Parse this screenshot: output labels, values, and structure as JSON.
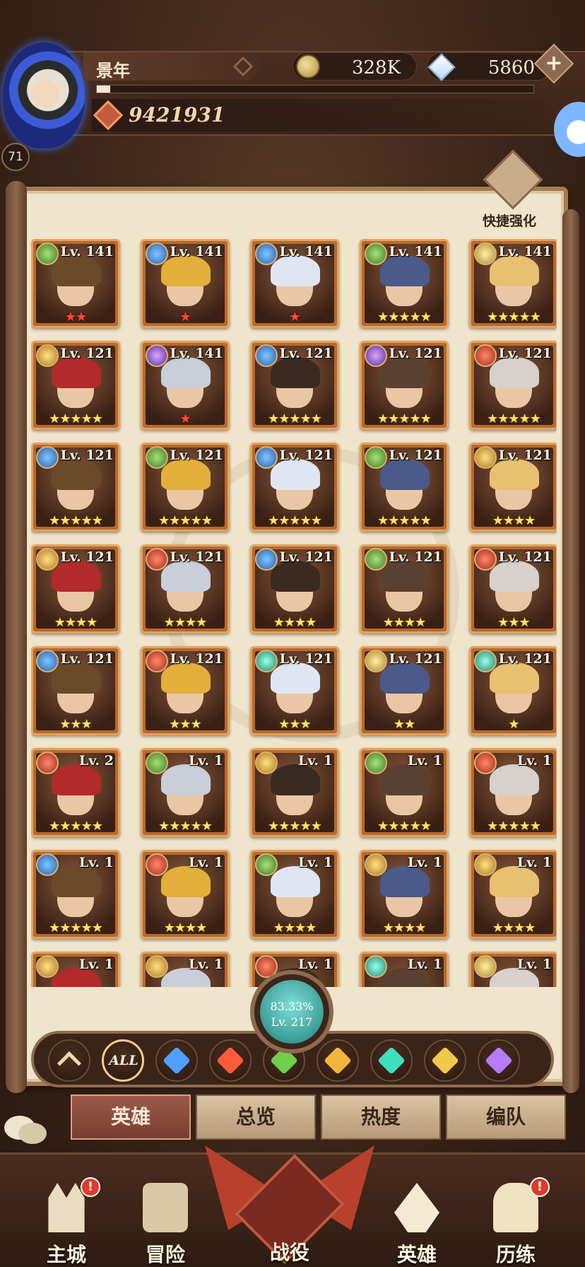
{
  "player": {
    "name": "景年",
    "level": "71",
    "power": "9421931",
    "xp_fraction": 0.03
  },
  "currency": {
    "gold": "328K",
    "gems": "5860",
    "add": "+"
  },
  "quick_upgrade": {
    "label": "快捷强化"
  },
  "heroes": [
    {
      "faction": "wild",
      "level": "Lv. 141",
      "stars": "★★",
      "star_color": "red"
    },
    {
      "faction": "water",
      "level": "Lv. 141",
      "stars": "★",
      "star_color": "red"
    },
    {
      "faction": "water",
      "level": "Lv. 141",
      "stars": "★",
      "star_color": "red"
    },
    {
      "faction": "wild",
      "level": "Lv. 141",
      "stars": "★★★★★",
      "star_color": "gold"
    },
    {
      "faction": "sun",
      "level": "Lv. 141",
      "stars": "★★★★★",
      "star_color": "gold"
    },
    {
      "faction": "light",
      "level": "Lv. 121",
      "stars": "★★★★★",
      "star_color": "gold"
    },
    {
      "faction": "void",
      "level": "Lv. 141",
      "stars": "★",
      "star_color": "red"
    },
    {
      "faction": "water",
      "level": "Lv. 121",
      "stars": "★★★★★",
      "star_color": "gold"
    },
    {
      "faction": "void",
      "level": "Lv. 121",
      "stars": "★★★★★",
      "star_color": "gold"
    },
    {
      "faction": "fire",
      "level": "Lv. 121",
      "stars": "★★★★★",
      "star_color": "gold"
    },
    {
      "faction": "water",
      "level": "Lv. 121",
      "stars": "★★★★★",
      "star_color": "gold"
    },
    {
      "faction": "wild",
      "level": "Lv. 121",
      "stars": "★★★★★",
      "star_color": "gold"
    },
    {
      "faction": "water",
      "level": "Lv. 121",
      "stars": "★★★★★",
      "star_color": "gold"
    },
    {
      "faction": "wild",
      "level": "Lv. 121",
      "stars": "★★★★★",
      "star_color": "gold"
    },
    {
      "faction": "light",
      "level": "Lv. 121",
      "stars": "★★★★",
      "star_color": "gold"
    },
    {
      "faction": "light",
      "level": "Lv. 121",
      "stars": "★★★★",
      "star_color": "gold"
    },
    {
      "faction": "fire",
      "level": "Lv. 121",
      "stars": "★★★★",
      "star_color": "gold"
    },
    {
      "faction": "water",
      "level": "Lv. 121",
      "stars": "★★★★",
      "star_color": "gold"
    },
    {
      "faction": "wild",
      "level": "Lv. 121",
      "stars": "★★★★",
      "star_color": "gold"
    },
    {
      "faction": "fire",
      "level": "Lv. 121",
      "stars": "★★★",
      "star_color": "gold"
    },
    {
      "faction": "water",
      "level": "Lv. 121",
      "stars": "★★★",
      "star_color": "gold"
    },
    {
      "faction": "fire",
      "level": "Lv. 121",
      "stars": "★★★",
      "star_color": "gold"
    },
    {
      "faction": "eye",
      "level": "Lv. 121",
      "stars": "★★★",
      "star_color": "gold"
    },
    {
      "faction": "sun",
      "level": "Lv. 121",
      "stars": "★★",
      "star_color": "gold"
    },
    {
      "faction": "eye",
      "level": "Lv. 121",
      "stars": "★",
      "star_color": "gold"
    },
    {
      "faction": "fire",
      "level": "Lv. 2",
      "stars": "★★★★★",
      "star_color": "gold"
    },
    {
      "faction": "wild",
      "level": "Lv. 1",
      "stars": "★★★★★",
      "star_color": "gold"
    },
    {
      "faction": "light",
      "level": "Lv. 1",
      "stars": "★★★★★",
      "star_color": "gold"
    },
    {
      "faction": "wild",
      "level": "Lv. 1",
      "stars": "★★★★★",
      "star_color": "gold"
    },
    {
      "faction": "fire",
      "level": "Lv. 1",
      "stars": "★★★★★",
      "star_color": "gold"
    },
    {
      "faction": "water",
      "level": "Lv. 1",
      "stars": "★★★★★",
      "star_color": "gold"
    },
    {
      "faction": "fire",
      "level": "Lv. 1",
      "stars": "★★★★",
      "star_color": "gold"
    },
    {
      "faction": "wild",
      "level": "Lv. 1",
      "stars": "★★★★",
      "star_color": "gold"
    },
    {
      "faction": "light",
      "level": "Lv. 1",
      "stars": "★★★★",
      "star_color": "gold"
    },
    {
      "faction": "light",
      "level": "Lv. 1",
      "stars": "★★★★",
      "star_color": "gold"
    },
    {
      "faction": "light",
      "level": "Lv. 1",
      "stars": "",
      "star_color": "gold"
    },
    {
      "faction": "light",
      "level": "Lv. 1",
      "stars": "",
      "star_color": "gold"
    },
    {
      "faction": "fire",
      "level": "Lv. 1",
      "stars": "",
      "star_color": "gold"
    },
    {
      "faction": "eye",
      "level": "Lv. 1",
      "stars": "",
      "star_color": "gold"
    },
    {
      "faction": "sun",
      "level": "Lv. 1",
      "stars": "",
      "star_color": "gold"
    }
  ],
  "collection": {
    "percent": "83.33%",
    "level": "Lv. 217"
  },
  "filters": [
    {
      "key": "collapse",
      "icon": "chevron-up-icon"
    },
    {
      "key": "all",
      "label": "ALL"
    },
    {
      "key": "water",
      "icon": "lightbearer-water-icon",
      "color": "#4fa0ff"
    },
    {
      "key": "fire",
      "icon": "mauler-fire-icon",
      "color": "#ff5a3a"
    },
    {
      "key": "wild",
      "icon": "wilder-leaf-icon",
      "color": "#6ed04a"
    },
    {
      "key": "light",
      "icon": "graveborn-star-icon",
      "color": "#f4b63a"
    },
    {
      "key": "eye",
      "icon": "celestial-eye-icon",
      "color": "#3fe0c0"
    },
    {
      "key": "sun",
      "icon": "dimensional-y-icon",
      "color": "#f2c84a"
    },
    {
      "key": "void",
      "icon": "hypogean-rune-icon",
      "color": "#b87aff"
    }
  ],
  "tabs": [
    "英雄",
    "总览",
    "热度",
    "编队"
  ],
  "nav": {
    "main": "主城",
    "adventure": "冒险",
    "campaign": "战役",
    "heroes": "英雄",
    "trials": "历练",
    "alert_mark": "!"
  }
}
